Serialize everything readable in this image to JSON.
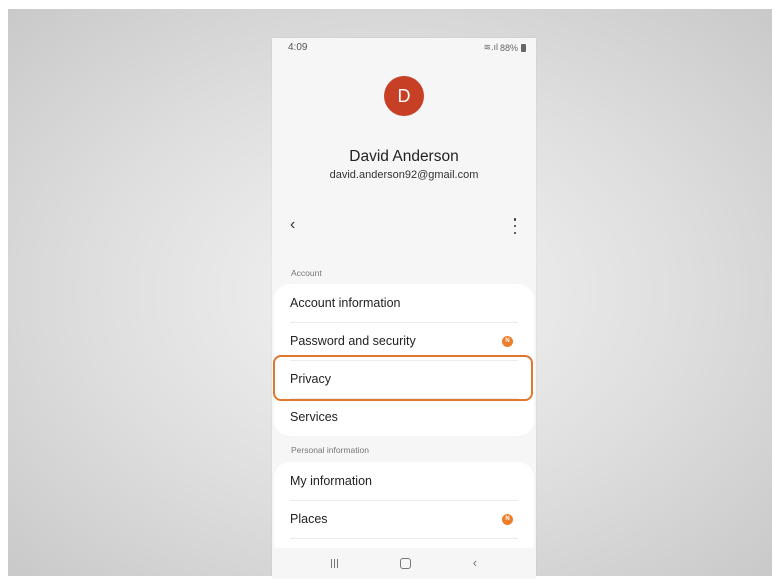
{
  "status_bar": {
    "time": "4:09",
    "battery": "88%",
    "signal_glyph": "≋.ıl"
  },
  "profile": {
    "avatar_initial": "D",
    "name": "David Anderson",
    "email": "david.anderson92@gmail.com",
    "avatar_color": "#c73f24"
  },
  "toolbar": {
    "back_glyph": "‹"
  },
  "sections": {
    "account": {
      "header": "Account",
      "items": [
        {
          "label": "Account information"
        },
        {
          "label": "Password and security",
          "badge": "N"
        },
        {
          "label": "Privacy"
        },
        {
          "label": "Services"
        }
      ]
    },
    "personal": {
      "header": "Personal information",
      "items": [
        {
          "label": "My information"
        },
        {
          "label": "Places",
          "badge": "N"
        }
      ]
    }
  },
  "navbar": {
    "back_glyph": "‹"
  },
  "colors": {
    "badge": "#ee7d2a",
    "highlight": "#e0772f"
  },
  "icons": [
    "wifi-icon",
    "signal-icon",
    "battery-icon",
    "back-arrow-icon",
    "more-vert-icon",
    "recent-apps-icon",
    "home-icon",
    "nav-back-icon"
  ]
}
